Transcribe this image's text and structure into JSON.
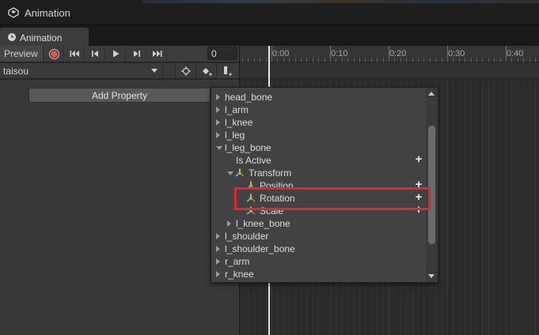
{
  "window": {
    "title": "Animation"
  },
  "tab": {
    "label": "Animation",
    "icon": "clock-icon"
  },
  "toolbar": {
    "preview_label": "Preview",
    "record_color": "#e8573b",
    "frame_value": "0"
  },
  "clip": {
    "selected": "taisou"
  },
  "left_pane": {
    "add_property_label": "Add Property"
  },
  "ruler": {
    "labels": [
      "0:00",
      "0:10",
      "0:20",
      "0:30",
      "0:40"
    ]
  },
  "property_list": {
    "items": [
      {
        "label": "head_bone",
        "expander": "right",
        "indent": 0
      },
      {
        "label": "l_arm",
        "expander": "right",
        "indent": 0
      },
      {
        "label": "l_knee",
        "expander": "right",
        "indent": 0
      },
      {
        "label": "l_leg",
        "expander": "right",
        "indent": 0
      },
      {
        "label": "l_leg_bone",
        "expander": "down",
        "indent": 0
      },
      {
        "label": "Is Active",
        "expander": "none",
        "indent": 1,
        "plus": true
      },
      {
        "label": "Transform",
        "expander": "down",
        "indent": 1,
        "icon": "transform-icon"
      },
      {
        "label": "Position",
        "expander": "none",
        "indent": 2,
        "icon": "transform-icon",
        "plus": true
      },
      {
        "label": "Rotation",
        "expander": "none",
        "indent": 2,
        "icon": "transform-icon",
        "plus": true,
        "highlighted": true
      },
      {
        "label": "Scale",
        "expander": "none",
        "indent": 2,
        "icon": "transform-icon",
        "plus": true
      },
      {
        "label": "l_knee_bone",
        "expander": "right",
        "indent": 1
      },
      {
        "label": "l_shoulder",
        "expander": "right",
        "indent": 0
      },
      {
        "label": "l_shoulder_bone",
        "expander": "right",
        "indent": 0
      },
      {
        "label": "r_arm",
        "expander": "right",
        "indent": 0
      },
      {
        "label": "r_knee",
        "expander": "right",
        "indent": 0
      }
    ],
    "plus_label": "+"
  },
  "colors": {
    "highlight": "#e3262d",
    "playhead": "#e8e8e8"
  }
}
